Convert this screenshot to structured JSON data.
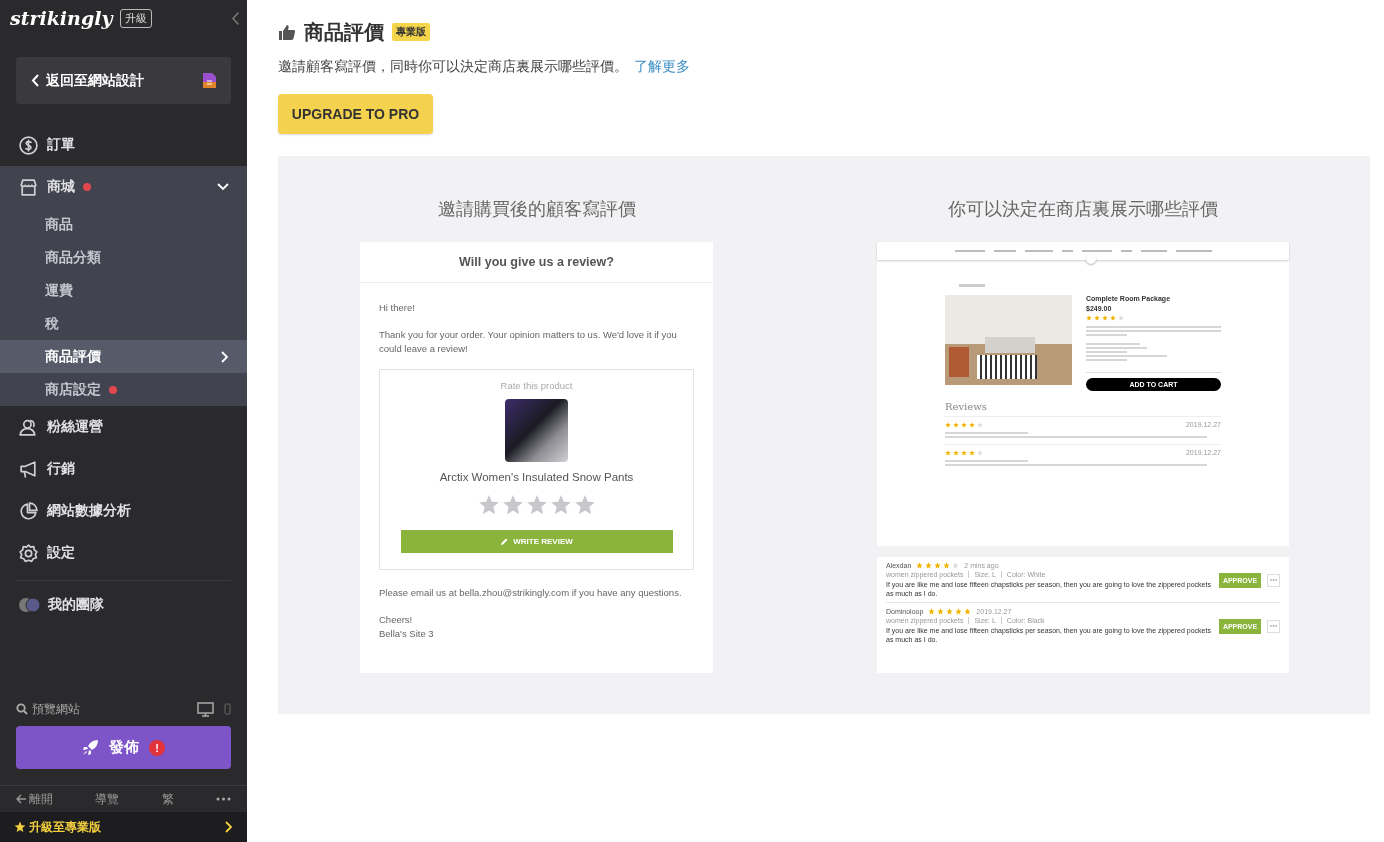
{
  "sidebar": {
    "brand": "strikingly",
    "upgrade_badge": "升級",
    "back_button": "返回至網站設計",
    "nav": [
      {
        "label": "訂單",
        "dot": false
      },
      {
        "label": "商城",
        "dot": true,
        "expanded": true,
        "children": [
          {
            "label": "商品",
            "selected": false,
            "dot": false
          },
          {
            "label": "商品分類",
            "selected": false,
            "dot": false
          },
          {
            "label": "運費",
            "selected": false,
            "dot": false
          },
          {
            "label": "稅",
            "selected": false,
            "dot": false
          },
          {
            "label": "商品評價",
            "selected": true,
            "dot": false
          },
          {
            "label": "商店設定",
            "selected": false,
            "dot": true
          }
        ]
      },
      {
        "label": "粉絲運營",
        "dot": false
      },
      {
        "label": "行銷",
        "dot": false
      },
      {
        "label": "網站數據分析",
        "dot": false
      },
      {
        "label": "設定",
        "dot": false
      }
    ],
    "team": "我的團隊",
    "preview": "預覽網站",
    "publish_button": "發佈",
    "publish_alert": "!",
    "footer": [
      "離開",
      "導覽",
      "繁"
    ],
    "upgrade_bar": "升級至專業版"
  },
  "main": {
    "title": "商品評價",
    "badge": "專業版",
    "description": "邀請顧客寫評價，同時你可以決定商店裏展示哪些評價。",
    "link": "了解更多",
    "upgrade_button": "UPGRADE TO PRO",
    "email_panel": {
      "title": "邀請購買後的顧客寫評價",
      "heading": "Will you give us a review?",
      "greeting": "Hi there!",
      "body": "Thank you for your order. Your opinion matters to us. We'd love it if you could leave a review!",
      "rate_label": "Rate this product",
      "product_name": "Arctix Women's Insulated Snow Pants",
      "stars": 0,
      "button": "WRITE REVIEW",
      "contact": "Please email us at bella.zhou@strikingly.com if you have any questions.",
      "sign_off": "Cheers!",
      "signature": "Bella's Site 3"
    },
    "display_panel": {
      "title": "你可以決定在商店裏展示哪些評價",
      "product_title": "Complete Room Package",
      "price": "$249.00",
      "stars": 4,
      "add_to_cart": "ADD TO CART",
      "reviews_heading": "Reviews",
      "site_reviews": [
        {
          "stars": 4,
          "date": "2019.12.27"
        },
        {
          "stars": 4,
          "date": "2019.12.27"
        }
      ],
      "moderation": [
        {
          "name": "Alexdan",
          "stars": 4,
          "time": "2 mins ago",
          "variant": "women zippered pockets",
          "size": "Size: L",
          "color_label": "Color: White",
          "text": "If you are like me and lose fifteen chapsticks per season, then you are going to love the zippered pockets as much as I do.",
          "button": "APPROVE"
        },
        {
          "name": "Dominoloop",
          "stars": 5,
          "time": "2019.12.27",
          "variant": "women zippered pockets",
          "size": "Size: L",
          "color_label": "Color: Black",
          "text": "If you are like me and lose fifteen chapsticks per season, then you are going to love the zippered pockets as much as I do.",
          "button": "APPROVE"
        }
      ]
    }
  }
}
